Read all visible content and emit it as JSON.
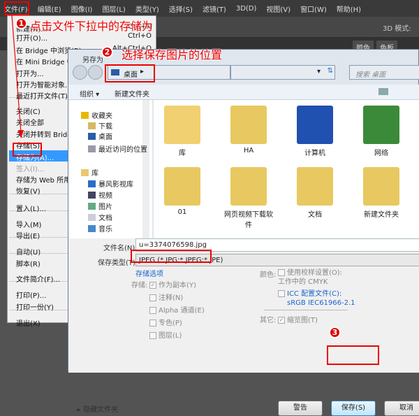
{
  "menubar": [
    "文件(F)",
    "编辑(E)",
    "图像(I)",
    "图层(L)",
    "类型(Y)",
    "选择(S)",
    "滤镜(T)",
    "3D(D)",
    "视图(V)",
    "窗口(W)",
    "帮助(H)"
  ],
  "toolbar": {
    "mode_label": "3D 模式:"
  },
  "panel_tabs": [
    "颜色",
    "色板"
  ],
  "file_menu": [
    {
      "label": "新建(N)...",
      "shortcut": "Ctrl+N"
    },
    {
      "label": "打开(O)...",
      "shortcut": "Ctrl+O"
    },
    {
      "label": "在 Bridge 中浏览(B)...",
      "shortcut": "Alt+Ctrl+O"
    },
    {
      "label": "在 Mini Bridge 中浏览(G)..."
    },
    {
      "label": "打开为..."
    },
    {
      "label": "打开为智能对象..."
    },
    {
      "label": "最近打开文件(T)"
    },
    {
      "label": "关闭(C)"
    },
    {
      "label": "关闭全部"
    },
    {
      "label": "关闭并转到 Bridge..."
    },
    {
      "label": "存储(S)"
    },
    {
      "label": "存储为(A)...",
      "highlighted": true
    },
    {
      "label": "签入(I)...",
      "disabled": true
    },
    {
      "label": "存储为 Web 所用格式..."
    },
    {
      "label": "恢复(V)"
    },
    {
      "label": "置入(L)..."
    },
    {
      "label": "导入(M)"
    },
    {
      "label": "导出(E)"
    },
    {
      "label": "自动(U)"
    },
    {
      "label": "脚本(R)"
    },
    {
      "label": "文件简介(F)..."
    },
    {
      "label": "打印(P)..."
    },
    {
      "label": "打印一份(Y)"
    },
    {
      "label": "退出(X)"
    }
  ],
  "dialog": {
    "title": "另存为",
    "address": "桌面",
    "search_placeholder": "搜索 桌面",
    "organize": "组织 ▾",
    "new_folder": "新建文件夹",
    "nav": [
      "收藏夹",
      "下载",
      "桌面",
      "最近访问的位置",
      "库",
      "暴风影视库",
      "视频",
      "图片",
      "文档",
      "音乐"
    ],
    "files": [
      "库",
      "HA",
      "计算机",
      "网络",
      "01",
      "网页视频下载软件",
      "文档",
      "新建文件夹"
    ],
    "filename_label": "文件名(N):",
    "filename": "u=3374076598.jpg",
    "filetype_label": "保存类型(T):",
    "filetype": "JPEG (*.JPG;*.JPEG;*.JPE)",
    "save_options": "存储选项",
    "save_label": "存储:",
    "save_checks": [
      {
        "label": "作为副本(Y)",
        "checked": true
      },
      {
        "label": "注释(N)",
        "checked": false
      },
      {
        "label": "Alpha 通道(E)",
        "checked": false
      },
      {
        "label": "专色(P)",
        "checked": false
      },
      {
        "label": "图层(L)",
        "checked": false
      }
    ],
    "color_label": "颜色:",
    "proof": "使用校样设置(O): 工作中的 CMYK",
    "icc": "ICC 配置文件(C):",
    "icc_profile": "sRGB IEC61966-2.1",
    "other_label": "其它:",
    "thumbnail": "缩览图(T)",
    "hide_folders": "隐藏文件夹",
    "warning_button": "警告",
    "save_button": "保存(S)",
    "cancel_button": "取消"
  },
  "annotations": {
    "step1": "点击文件下拉中的存储为",
    "step2": "选择保存图片的位置",
    "n1": "1",
    "n2": "2",
    "n3": "3",
    "color": "#e00000"
  }
}
